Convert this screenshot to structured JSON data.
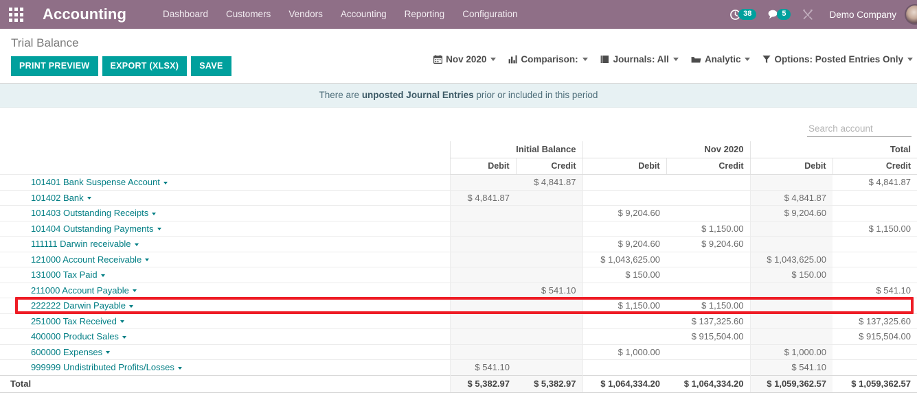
{
  "navbar": {
    "apps_icon": "apps-grid-icon",
    "brand": "Accounting",
    "menu_items": [
      {
        "label": "Dashboard"
      },
      {
        "label": "Customers"
      },
      {
        "label": "Vendors"
      },
      {
        "label": "Accounting"
      },
      {
        "label": "Reporting"
      },
      {
        "label": "Configuration"
      }
    ],
    "activities": {
      "icon": "clock-activity-icon",
      "count": "38"
    },
    "messages": {
      "icon": "chat-bubble-icon",
      "count": "5"
    },
    "debug": {
      "icon": "wrench-screwdriver-icon"
    },
    "company": "Demo Company",
    "avatar": {
      "icon": "user-avatar"
    }
  },
  "control_panel": {
    "title": "Trial Balance",
    "buttons": [
      {
        "label": "PRINT PREVIEW",
        "name": "print-preview-button"
      },
      {
        "label": "EXPORT (XLSX)",
        "name": "export-xlsx-button"
      },
      {
        "label": "SAVE",
        "name": "save-button"
      }
    ],
    "filters": [
      {
        "label": "Nov 2020",
        "icon": "calendar-icon",
        "name": "date-filter"
      },
      {
        "label": "Comparison:",
        "icon": "bar-chart-icon",
        "name": "comparison-filter"
      },
      {
        "label": "Journals: All",
        "icon": "book-icon",
        "name": "journals-filter"
      },
      {
        "label": "Analytic",
        "icon": "folder-icon",
        "name": "analytic-filter"
      },
      {
        "label": "Options: Posted Entries Only",
        "icon": "funnel-icon",
        "name": "options-filter"
      }
    ]
  },
  "warning": {
    "prefix": "There are ",
    "bold": "unposted Journal Entries",
    "suffix": " prior or included in this period"
  },
  "search": {
    "placeholder": "Search account",
    "value": "",
    "icon": "search-icon"
  },
  "table": {
    "group_headers": [
      {
        "label": ""
      },
      {
        "label": "Initial Balance"
      },
      {
        "label": "Nov 2020"
      },
      {
        "label": "Total"
      }
    ],
    "sub_headers": {
      "name": "",
      "initial_debit": "Debit",
      "initial_credit": "Credit",
      "period_debit": "Debit",
      "period_credit": "Credit",
      "total_debit": "Debit",
      "total_credit": "Credit"
    },
    "rows": [
      {
        "name": "101401 Bank Suspense Account",
        "ib_d": "",
        "ib_c": "$ 4,841.87",
        "p_d": "",
        "p_c": "",
        "t_d": "",
        "t_c": "$ 4,841.87"
      },
      {
        "name": "101402 Bank",
        "ib_d": "$ 4,841.87",
        "ib_c": "",
        "p_d": "",
        "p_c": "",
        "t_d": "$ 4,841.87",
        "t_c": ""
      },
      {
        "name": "101403 Outstanding Receipts",
        "ib_d": "",
        "ib_c": "",
        "p_d": "$ 9,204.60",
        "p_c": "",
        "t_d": "$ 9,204.60",
        "t_c": ""
      },
      {
        "name": "101404 Outstanding Payments",
        "ib_d": "",
        "ib_c": "",
        "p_d": "",
        "p_c": "$ 1,150.00",
        "t_d": "",
        "t_c": "$ 1,150.00"
      },
      {
        "name": "111111 Darwin receivable",
        "ib_d": "",
        "ib_c": "",
        "p_d": "$ 9,204.60",
        "p_c": "$ 9,204.60",
        "t_d": "",
        "t_c": ""
      },
      {
        "name": "121000 Account Receivable",
        "ib_d": "",
        "ib_c": "",
        "p_d": "$ 1,043,625.00",
        "p_c": "",
        "t_d": "$ 1,043,625.00",
        "t_c": ""
      },
      {
        "name": "131000 Tax Paid",
        "ib_d": "",
        "ib_c": "",
        "p_d": "$ 150.00",
        "p_c": "",
        "t_d": "$ 150.00",
        "t_c": ""
      },
      {
        "name": "211000 Account Payable",
        "ib_d": "",
        "ib_c": "$ 541.10",
        "p_d": "",
        "p_c": "",
        "t_d": "",
        "t_c": "$ 541.10"
      },
      {
        "name": "222222 Darwin Payable",
        "ib_d": "",
        "ib_c": "",
        "p_d": "$ 1,150.00",
        "p_c": "$ 1,150.00",
        "t_d": "",
        "t_c": "",
        "highlighted": true
      },
      {
        "name": "251000 Tax Received",
        "ib_d": "",
        "ib_c": "",
        "p_d": "",
        "p_c": "$ 137,325.60",
        "t_d": "",
        "t_c": "$ 137,325.60"
      },
      {
        "name": "400000 Product Sales",
        "ib_d": "",
        "ib_c": "",
        "p_d": "",
        "p_c": "$ 915,504.00",
        "t_d": "",
        "t_c": "$ 915,504.00"
      },
      {
        "name": "600000 Expenses",
        "ib_d": "",
        "ib_c": "",
        "p_d": "$ 1,000.00",
        "p_c": "",
        "t_d": "$ 1,000.00",
        "t_c": ""
      },
      {
        "name": "999999 Undistributed Profits/Losses",
        "ib_d": "$ 541.10",
        "ib_c": "",
        "p_d": "",
        "p_c": "",
        "t_d": "$ 541.10",
        "t_c": ""
      }
    ],
    "total_row": {
      "name": "Total",
      "ib_d": "$ 5,382.97",
      "ib_c": "$ 5,382.97",
      "p_d": "$ 1,064,334.20",
      "p_c": "$ 1,064,334.20",
      "t_d": "$ 1,059,362.57",
      "t_c": "$ 1,059,362.57"
    }
  },
  "annotation": {
    "highlight_color": "#ee1c25",
    "target_row": "222222 Darwin Payable"
  }
}
